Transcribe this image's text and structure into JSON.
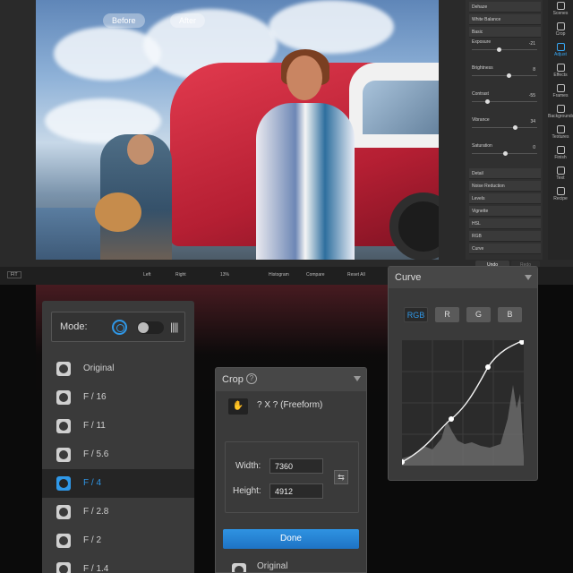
{
  "photo": {
    "before_label": "Before",
    "after_label": "After"
  },
  "adjust_panel": {
    "sections_top": [
      "Dehaze",
      "White Balance",
      "Basic"
    ],
    "sliders": [
      {
        "label": "Exposure",
        "value": "-21",
        "knob": 0.4
      },
      {
        "label": "Brightness",
        "value": "8",
        "knob": 0.55
      },
      {
        "label": "Contrast",
        "value": "-55",
        "knob": 0.22
      },
      {
        "label": "Vibrance",
        "value": "34",
        "knob": 0.66
      },
      {
        "label": "Saturation",
        "value": "0",
        "knob": 0.5
      }
    ],
    "sections_bottom": [
      "Detail",
      "Noise Reduction",
      "Levels",
      "Vignette",
      "HSL",
      "RGB",
      "Curve"
    ]
  },
  "tools": [
    {
      "label": "Scenes",
      "active": false
    },
    {
      "label": "Crop",
      "active": false
    },
    {
      "label": "Adjust",
      "active": true
    },
    {
      "label": "Effects",
      "active": false
    },
    {
      "label": "Frames",
      "active": false
    },
    {
      "label": "Backgrounds",
      "active": false
    },
    {
      "label": "Textures",
      "active": false
    },
    {
      "label": "Finish",
      "active": false
    },
    {
      "label": "Text",
      "active": false
    },
    {
      "label": "Recipe",
      "active": false
    }
  ],
  "bottom_bar": {
    "fit": "FIT",
    "left": "Left",
    "right": "Right",
    "zoom": "13%",
    "histogram": "Histogram",
    "compare": "Compare",
    "reset": "Reset All",
    "undo": "Undo",
    "redo": "Redo"
  },
  "mode_panel": {
    "label": "Mode:",
    "items": [
      {
        "label": "Original",
        "selected": false
      },
      {
        "label": "F / 16",
        "selected": false
      },
      {
        "label": "F / 11",
        "selected": false
      },
      {
        "label": "F / 5.6",
        "selected": false
      },
      {
        "label": "F / 4",
        "selected": true
      },
      {
        "label": "F / 2.8",
        "selected": false
      },
      {
        "label": "F / 2",
        "selected": false
      },
      {
        "label": "F / 1.4",
        "selected": false
      }
    ]
  },
  "crop_panel": {
    "title": "Crop",
    "ratio": "? X ? (Freeform)",
    "width_label": "Width:",
    "width_value": "7360",
    "height_label": "Height:",
    "height_value": "4912",
    "done": "Done",
    "original": "Original"
  },
  "curve_panel": {
    "title": "Curve",
    "channels": [
      {
        "label": "RGB",
        "active": true
      },
      {
        "label": "R",
        "active": false
      },
      {
        "label": "G",
        "active": false
      },
      {
        "label": "B",
        "active": false
      }
    ]
  },
  "colors": {
    "accent": "#2f98e8",
    "panel": "#3a3a3a",
    "car_red": "#d3283f"
  }
}
